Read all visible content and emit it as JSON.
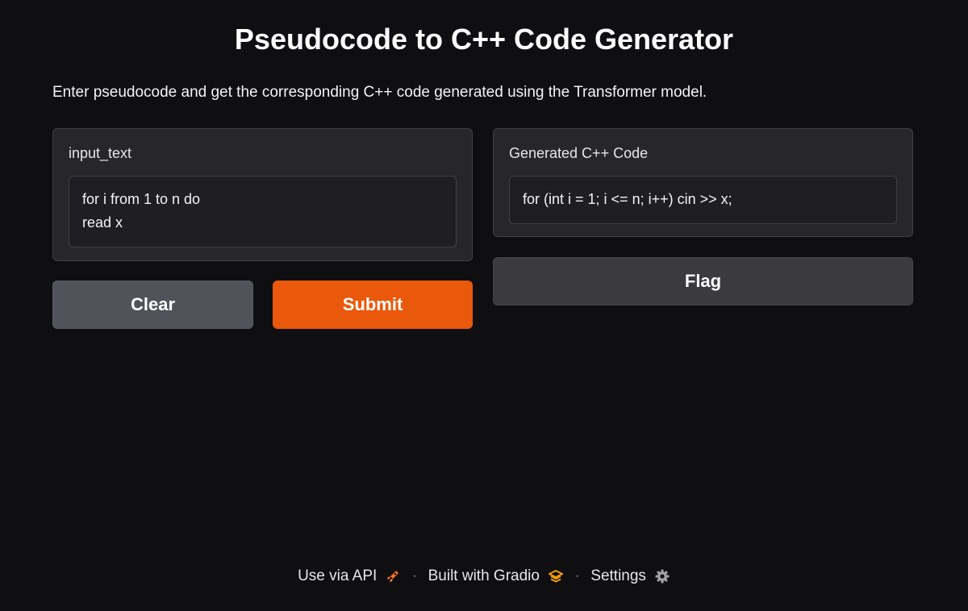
{
  "header": {
    "title": "Pseudocode to C++ Code Generator",
    "description": "Enter pseudocode and get the corresponding C++ code generated using the Transformer model."
  },
  "input_panel": {
    "label": "input_text",
    "value": "for i from 1 to n do\nread x"
  },
  "output_panel": {
    "label": "Generated C++ Code",
    "value": "for (int i = 1; i <= n; i++) cin >> x;"
  },
  "buttons": {
    "clear_label": "Clear",
    "submit_label": "Submit",
    "flag_label": "Flag"
  },
  "footer": {
    "api_label": "Use via API",
    "built_label": "Built with Gradio",
    "settings_label": "Settings",
    "separator": "·"
  },
  "colors": {
    "background": "#0f0f11",
    "panel": "#27272a",
    "submit_accent": "#ea580c",
    "clear": "#52525b",
    "flag": "#3a3a3f",
    "gradio_logo": "#f59e0b"
  },
  "icons": {
    "api": "rocket-icon",
    "gradio": "gradio-logo-icon",
    "settings": "gear-icon"
  }
}
